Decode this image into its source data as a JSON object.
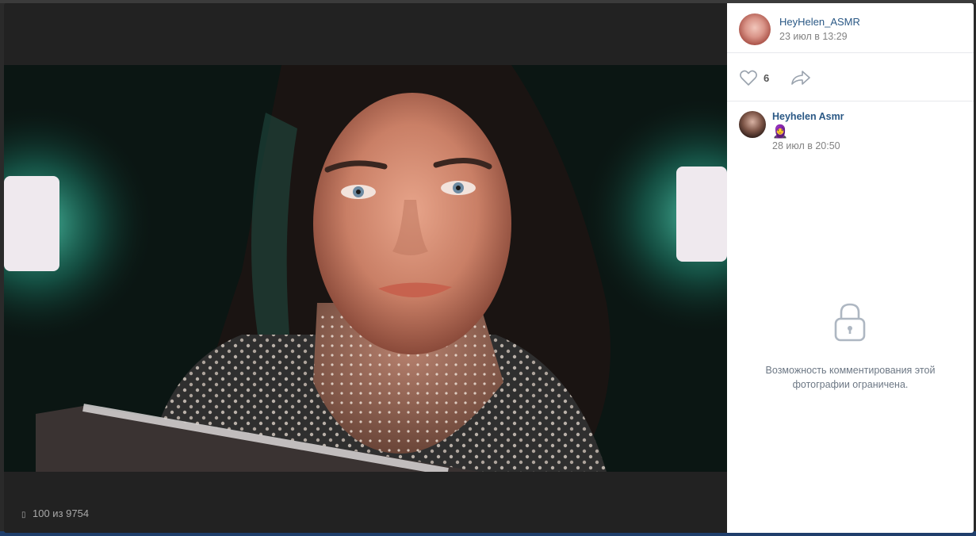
{
  "post": {
    "author": "HeyHelen_ASMR",
    "date": "23 июл в 13:29",
    "likes": "6"
  },
  "comments": [
    {
      "author": "Heyhelen Asmr",
      "emoji": "🧕",
      "date": "28 июл в 20:50"
    }
  ],
  "comments_locked_text": "Возможность комментирования этой фотографии ограничена.",
  "photo_counter": "100 из 9754",
  "icons": {
    "like": "heart-icon",
    "share": "share-arrow-icon",
    "lock": "lock-icon",
    "counter": "photo-icon"
  },
  "colors": {
    "link": "#2a5885",
    "muted": "#828282",
    "viewer_bg": "#222222"
  }
}
